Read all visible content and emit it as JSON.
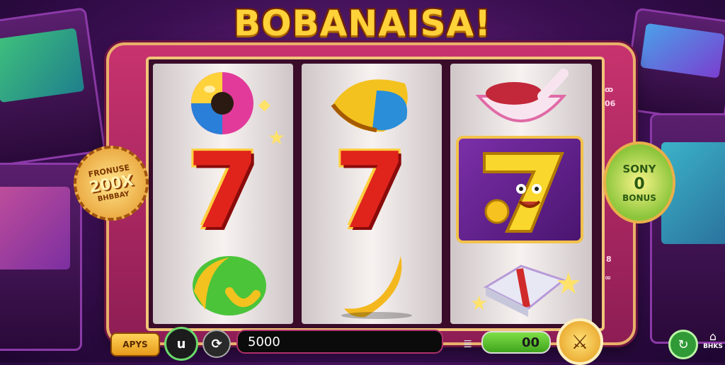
{
  "title": "BOBANAISA!",
  "left_badge": {
    "line1": "FRONUSE",
    "line2": "200X",
    "line3": "BHBBAY"
  },
  "right_badge": {
    "line1": "SONY",
    "line2": "0",
    "line3": "BONUS"
  },
  "reels": [
    {
      "symbols": [
        "donut-icon",
        "red-seven",
        "green-melon-icon"
      ]
    },
    {
      "symbols": [
        "taco-shell-icon",
        "red-seven",
        "banana-icon"
      ]
    },
    {
      "symbols": [
        "sushi-bowl-icon",
        "smiling-seven-bonus",
        "gem-box-icon"
      ]
    }
  ],
  "seven_glyph": "7",
  "right_side_marks": {
    "top": "ꝏ",
    "mid": "06",
    "bottom": "8",
    "bottom2": "∞"
  },
  "bottom_bar": {
    "apps_label": "APYS",
    "dark_button_label": "u",
    "gear_label": "⟳",
    "bet_value": "5000",
    "coin_symbol": "≣",
    "win_value": "00",
    "spin_label": "⚔",
    "green_button_label": "↻",
    "home_label": "BHKS"
  },
  "colors": {
    "title_gold": "#ffd23a",
    "frame_pink": "#c8336e",
    "seven_red": "#e0241c",
    "win_green": "#3fa31c"
  }
}
